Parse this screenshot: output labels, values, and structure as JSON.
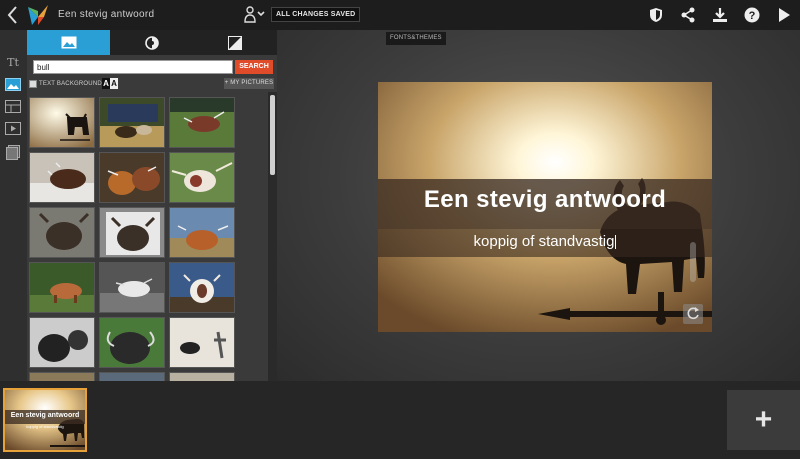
{
  "topbar": {
    "title": "Een stevig antwoord",
    "saved_status": "ALL CHANGES SAVED",
    "icons": [
      "back-icon",
      "logo-icon",
      "people-icon",
      "shield-icon",
      "share-icon",
      "download-icon",
      "help-icon",
      "present-icon"
    ],
    "fonts_themes_label": "FONTS&THEMES"
  },
  "rail": {
    "items": [
      {
        "name": "text",
        "label": "Tt",
        "active": false
      },
      {
        "name": "pictures",
        "label": "",
        "active": true
      },
      {
        "name": "layout",
        "label": "",
        "active": false
      },
      {
        "name": "video",
        "label": "",
        "active": false
      },
      {
        "name": "pages",
        "label": "",
        "active": false
      }
    ]
  },
  "panel": {
    "tabs": [
      {
        "name": "pictures-tab",
        "icon": "image-icon",
        "active": true
      },
      {
        "name": "filters-tab",
        "icon": "filter-icon",
        "active": false
      },
      {
        "name": "contrast-tab",
        "icon": "contrast-icon",
        "active": false
      }
    ],
    "search_value": "bull",
    "search_button": "SEARCH",
    "text_background_label": "TEXT BACKGROUND",
    "aa_label": "A",
    "my_pictures_label": "+ MY PICTURES"
  },
  "slide": {
    "title": "Een stevig antwoord",
    "subtitle": "koppig of standvastig"
  },
  "bottom": {
    "thumb_title": "Een stevig antwoord",
    "thumb_subtitle": "koppig of standvastig",
    "add_label": "+"
  },
  "colors": {
    "accent_blue": "#2a9fd6",
    "search_red": "#e04b2a",
    "thumb_border": "#e7a23a"
  }
}
